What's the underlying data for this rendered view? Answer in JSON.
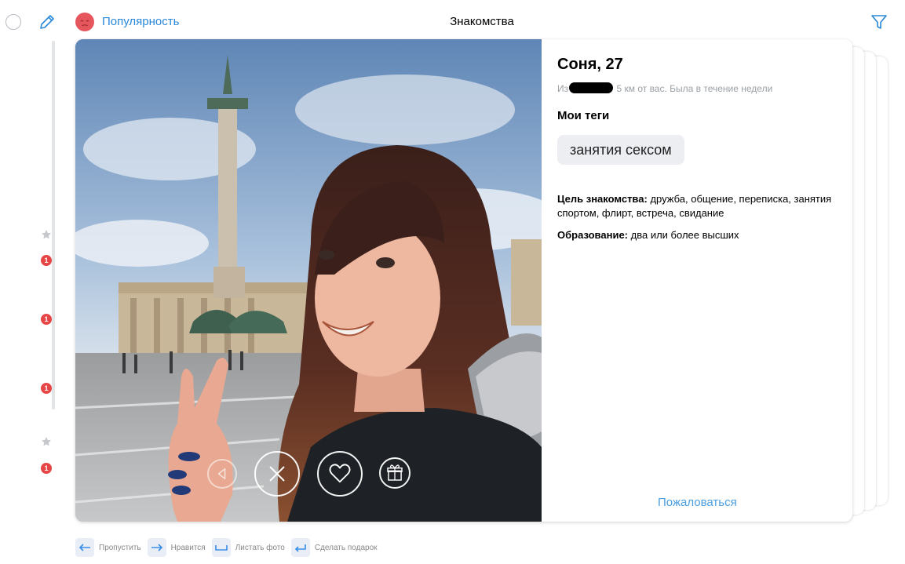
{
  "header": {
    "popularity_label": "Популярность",
    "title": "Знакомства"
  },
  "rail": {
    "badges": [
      "1",
      "1",
      "1",
      "1"
    ]
  },
  "profile": {
    "name_age": "Соня, 27",
    "location_prefix": "Из",
    "location_suffix": "5 км от вас. Была в течение недели",
    "tags_title": "Мои теги",
    "tags": [
      "занятия сексом"
    ],
    "goal_label": "Цель знакомства:",
    "goal_value": "дружба, общение, переписка, занятия спортом, флирт, встреча, свидание",
    "education_label": "Образование:",
    "education_value": "два или более высших",
    "report_label": "Пожаловаться"
  },
  "hotkeys": [
    {
      "icon": "arrow-left-icon",
      "label": "Пропустить"
    },
    {
      "icon": "arrow-right-icon",
      "label": "Нравится"
    },
    {
      "icon": "space-key-icon",
      "label": "Листать фото"
    },
    {
      "icon": "enter-key-icon",
      "label": "Сделать подарок"
    }
  ],
  "colors": {
    "accent": "#2a88d8",
    "badge": "#e64646",
    "mood": "#e5575c"
  }
}
